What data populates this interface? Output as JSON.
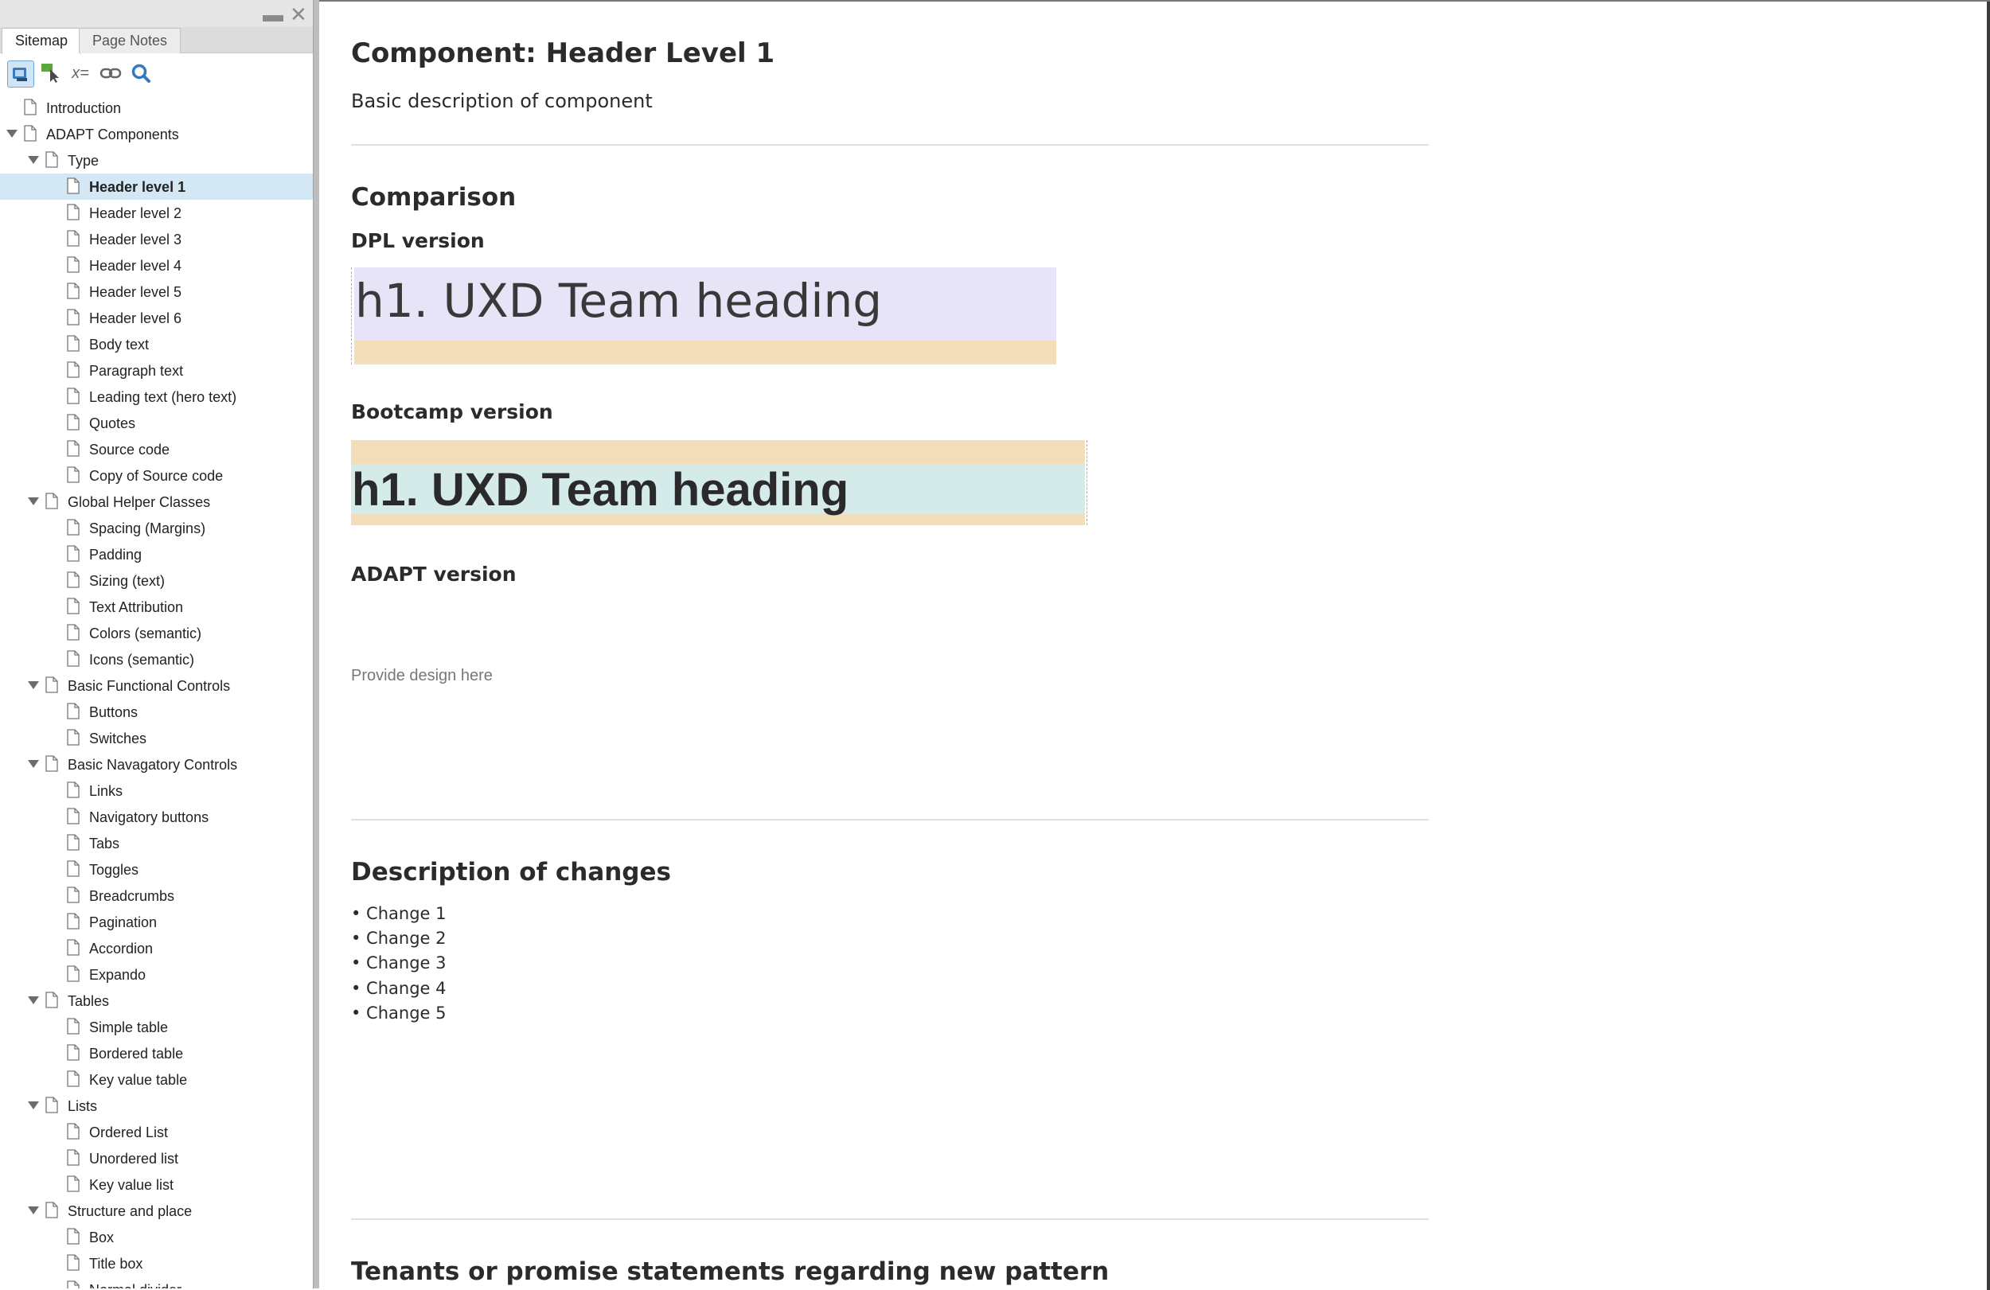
{
  "sidebar": {
    "tabs": [
      {
        "label": "Sitemap",
        "active": true
      },
      {
        "label": "Page Notes",
        "active": false
      }
    ],
    "window_controls": {
      "minimize": "▬",
      "close": "✕"
    },
    "tools": [
      "sitemap-view-icon",
      "cursor-icon",
      "variable-icon",
      "link-icon",
      "search-icon"
    ],
    "tools_text": {
      "variable": "x="
    },
    "tree": [
      {
        "label": "Introduction",
        "level": 0,
        "expandable": false
      },
      {
        "label": "ADAPT Components",
        "level": 0,
        "expandable": true
      },
      {
        "label": "Type",
        "level": 1,
        "expandable": true
      },
      {
        "label": "Header level 1",
        "level": 2,
        "expandable": false,
        "selected": true
      },
      {
        "label": "Header level 2",
        "level": 2,
        "expandable": false
      },
      {
        "label": "Header level 3",
        "level": 2,
        "expandable": false
      },
      {
        "label": "Header level 4",
        "level": 2,
        "expandable": false
      },
      {
        "label": "Header level 5",
        "level": 2,
        "expandable": false
      },
      {
        "label": "Header level 6",
        "level": 2,
        "expandable": false
      },
      {
        "label": "Body text",
        "level": 2,
        "expandable": false
      },
      {
        "label": "Paragraph text",
        "level": 2,
        "expandable": false
      },
      {
        "label": "Leading text (hero text)",
        "level": 2,
        "expandable": false
      },
      {
        "label": "Quotes",
        "level": 2,
        "expandable": false
      },
      {
        "label": "Source code",
        "level": 2,
        "expandable": false
      },
      {
        "label": "Copy of Source code",
        "level": 2,
        "expandable": false
      },
      {
        "label": "Global Helper Classes",
        "level": 1,
        "expandable": true
      },
      {
        "label": "Spacing (Margins)",
        "level": 2,
        "expandable": false
      },
      {
        "label": "Padding",
        "level": 2,
        "expandable": false
      },
      {
        "label": "Sizing (text)",
        "level": 2,
        "expandable": false
      },
      {
        "label": "Text Attribution",
        "level": 2,
        "expandable": false
      },
      {
        "label": "Colors (semantic)",
        "level": 2,
        "expandable": false
      },
      {
        "label": "Icons (semantic)",
        "level": 2,
        "expandable": false
      },
      {
        "label": "Basic Functional Controls",
        "level": 1,
        "expandable": true
      },
      {
        "label": "Buttons",
        "level": 2,
        "expandable": false
      },
      {
        "label": "Switches",
        "level": 2,
        "expandable": false
      },
      {
        "label": "Basic Navagatory Controls",
        "level": 1,
        "expandable": true
      },
      {
        "label": "Links",
        "level": 2,
        "expandable": false
      },
      {
        "label": "Navigatory buttons",
        "level": 2,
        "expandable": false
      },
      {
        "label": "Tabs",
        "level": 2,
        "expandable": false
      },
      {
        "label": "Toggles",
        "level": 2,
        "expandable": false
      },
      {
        "label": "Breadcrumbs",
        "level": 2,
        "expandable": false
      },
      {
        "label": "Pagination",
        "level": 2,
        "expandable": false
      },
      {
        "label": "Accordion",
        "level": 2,
        "expandable": false
      },
      {
        "label": "Expando",
        "level": 2,
        "expandable": false
      },
      {
        "label": "Tables",
        "level": 1,
        "expandable": true
      },
      {
        "label": "Simple table",
        "level": 2,
        "expandable": false
      },
      {
        "label": "Bordered table",
        "level": 2,
        "expandable": false
      },
      {
        "label": "Key value table",
        "level": 2,
        "expandable": false
      },
      {
        "label": "Lists",
        "level": 1,
        "expandable": true
      },
      {
        "label": "Ordered List",
        "level": 2,
        "expandable": false
      },
      {
        "label": "Unordered list",
        "level": 2,
        "expandable": false
      },
      {
        "label": "Key value list",
        "level": 2,
        "expandable": false
      },
      {
        "label": "Structure and place",
        "level": 1,
        "expandable": true
      },
      {
        "label": "Box",
        "level": 2,
        "expandable": false
      },
      {
        "label": "Title box",
        "level": 2,
        "expandable": false
      },
      {
        "label": "Normal divider",
        "level": 2,
        "expandable": false
      }
    ]
  },
  "main": {
    "title": "Component: Header Level 1",
    "description": "Basic description of component",
    "comparison": {
      "heading": "Comparison",
      "dpl_label": "DPL version",
      "dpl_sample": "h1. UXD Team heading",
      "bootcamp_label": "Bootcamp version",
      "bootcamp_sample": "h1. UXD Team heading",
      "adapt_label": "ADAPT version",
      "adapt_placeholder": "Provide design here"
    },
    "changes": {
      "heading": "Description of changes",
      "items": [
        "• Change 1",
        "• Change 2",
        "• Change 3",
        "• Change 4",
        "• Change 5"
      ]
    },
    "tenants_heading": "Tenants or promise statements regarding new pattern"
  },
  "colors": {
    "selected_row": "#d3e7f4",
    "dpl_text_bg": "#e6e4f6",
    "margin_bg": "#f2dfb9",
    "bootcamp_text_bg": "#d4ebea"
  }
}
